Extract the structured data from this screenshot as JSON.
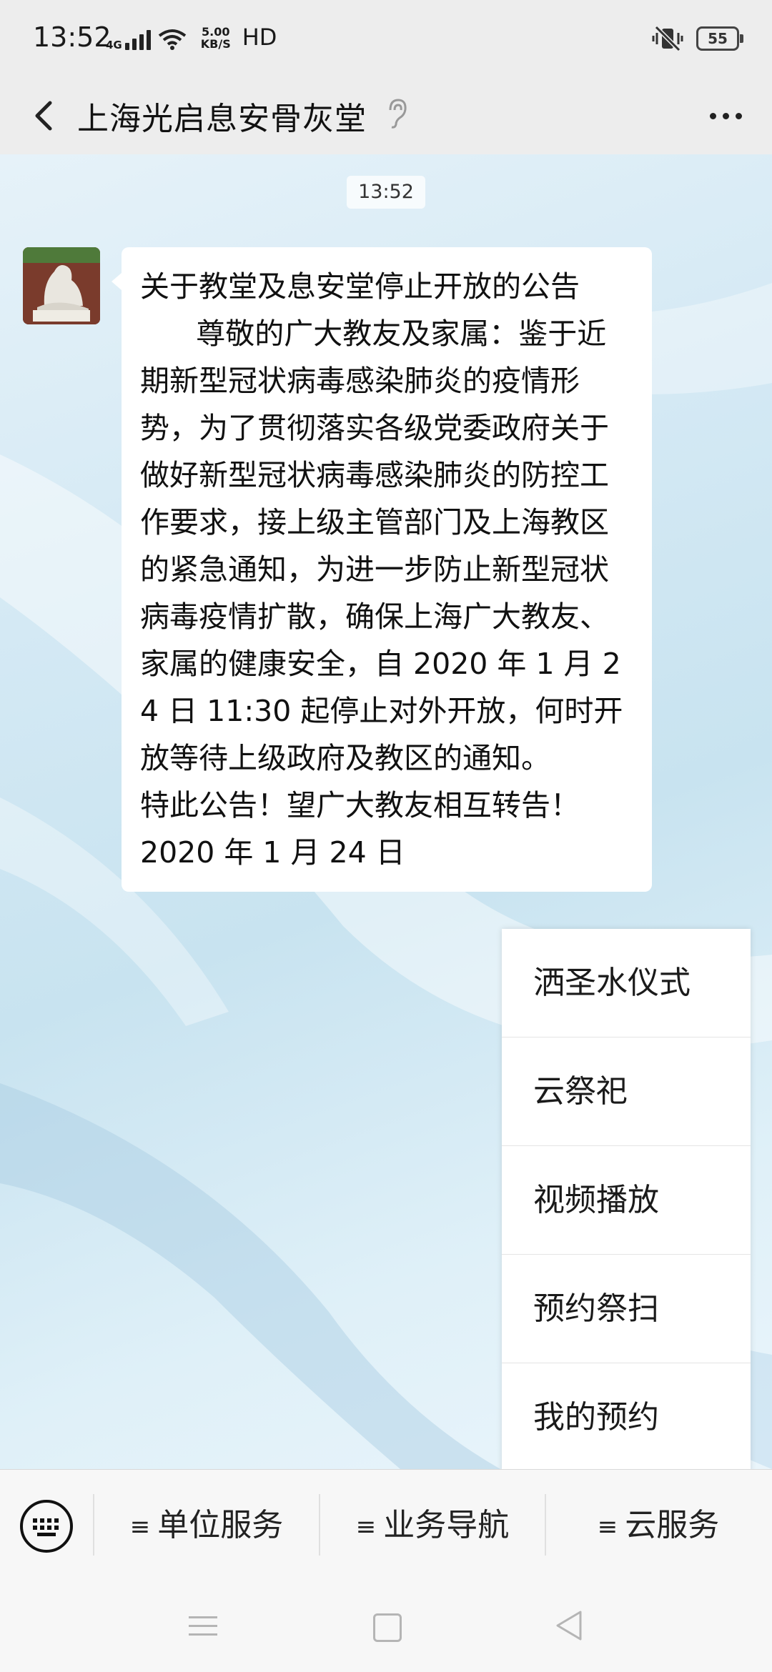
{
  "status_bar": {
    "time": "13:52",
    "network": "4G",
    "speed_top": "5.00",
    "speed_unit": "KB/S",
    "hd": "HD",
    "battery": "55",
    "icons": [
      "signal-icon",
      "wifi-icon",
      "mute-vibrate-icon",
      "battery-icon"
    ]
  },
  "header": {
    "title": "上海光启息安骨灰堂",
    "icons": [
      "back-arrow-icon",
      "ear-icon",
      "more-icon"
    ]
  },
  "chat": {
    "timestamp": "13:52",
    "message": "关于教堂及息安堂停止开放的公告\n      尊敬的广大教友及家属：鉴于近期新型冠状病毒感染肺炎的疫情形势，为了贯彻落实各级党委政府关于做好新型冠状病毒感染肺炎的防控工作要求，接上级主管部门及上海教区的紧急通知，为进一步防止新型冠状病毒疫情扩散，确保上海广大教友、家属的健康安全，自 2020 年 1 月 24 日 11:30 起停止对外开放，何时开放等待上级政府及教区的通知。\n特此公告！望广大教友相互转告！\n2020 年 1 月 24 日"
  },
  "popup_menu": {
    "items": [
      {
        "label": "洒圣水仪式"
      },
      {
        "label": "云祭祀"
      },
      {
        "label": "视频播放"
      },
      {
        "label": "预约祭扫"
      },
      {
        "label": "我的预约"
      }
    ]
  },
  "service_bar": {
    "icons": [
      "keyboard-icon"
    ],
    "menus": [
      {
        "label": "单位服务"
      },
      {
        "label": "业务导航"
      },
      {
        "label": "云服务"
      }
    ]
  },
  "nav_bar": {
    "icons": [
      "menu-icon",
      "home-icon",
      "back-icon"
    ]
  }
}
